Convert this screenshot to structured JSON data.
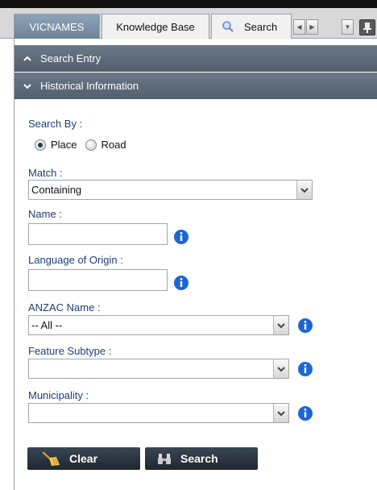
{
  "tabs": [
    {
      "label": "VICNAMES",
      "active": true
    },
    {
      "label": "Knowledge Base",
      "active": false
    },
    {
      "label": "Search",
      "active": false
    }
  ],
  "accordion": {
    "search_entry": "Search Entry",
    "historical_info": "Historical Information"
  },
  "form": {
    "search_by_label": "Search By :",
    "radio_place": "Place",
    "radio_road": "Road",
    "selected_radio": "Place",
    "match_label": "Match :",
    "match_value": "Containing",
    "name_label": "Name :",
    "name_value": "",
    "language_label": "Language of Origin :",
    "language_value": "",
    "anzac_label": "ANZAC Name :",
    "anzac_value": "-- All --",
    "feature_label": "Feature Subtype :",
    "feature_value": "",
    "municipality_label": "Municipality :",
    "municipality_value": ""
  },
  "buttons": {
    "clear": "Clear",
    "search": "Search"
  },
  "colors": {
    "header_bg": "#5e6b7a",
    "label_blue": "#1f3d75",
    "button_bg": "#2a3440",
    "info_blue": "#1e66d0"
  }
}
